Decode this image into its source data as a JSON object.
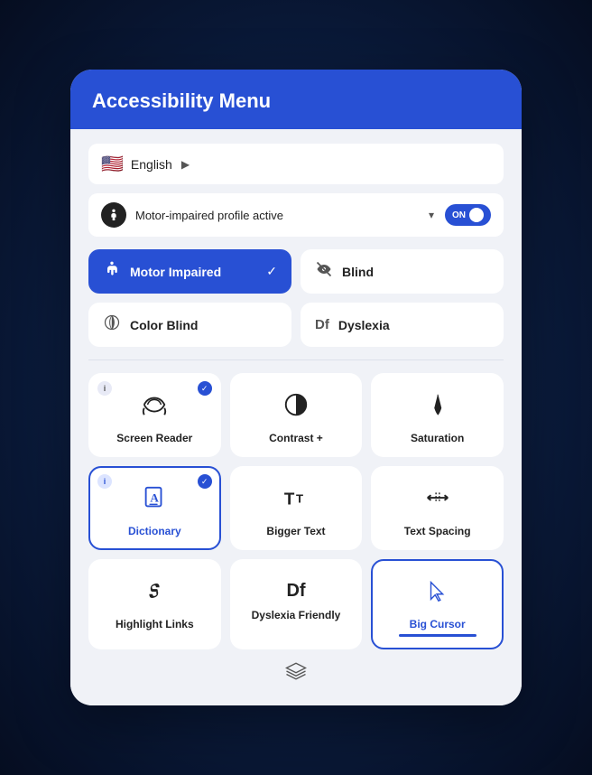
{
  "header": {
    "title": "Accessibility Menu"
  },
  "language": {
    "label": "English",
    "arrow": "▶"
  },
  "profile": {
    "label": "Motor-impaired profile active",
    "dropdown_arrow": "▾",
    "toggle_label": "ON"
  },
  "profiles": [
    {
      "id": "motor-impaired",
      "label": "Motor Impaired",
      "active": true
    },
    {
      "id": "blind",
      "label": "Blind",
      "active": false
    },
    {
      "id": "color-blind",
      "label": "Color Blind",
      "active": false
    },
    {
      "id": "dyslexia",
      "label": "Dyslexia",
      "active": false
    }
  ],
  "features": [
    {
      "id": "screen-reader",
      "label": "Screen Reader",
      "has_info": true,
      "has_check": true,
      "active": false
    },
    {
      "id": "contrast",
      "label": "Contrast +",
      "has_info": false,
      "has_check": false,
      "active": false
    },
    {
      "id": "saturation",
      "label": "Saturation",
      "has_info": false,
      "has_check": false,
      "active": false
    },
    {
      "id": "dictionary",
      "label": "Dictionary",
      "has_info": true,
      "has_check": true,
      "active": true
    },
    {
      "id": "bigger-text",
      "label": "Bigger Text",
      "has_info": false,
      "has_check": false,
      "active": false
    },
    {
      "id": "text-spacing",
      "label": "Text Spacing",
      "has_info": false,
      "has_check": false,
      "active": false
    },
    {
      "id": "highlight-links",
      "label": "Highlight Links",
      "has_info": false,
      "has_check": false,
      "active": false
    },
    {
      "id": "dyslexia-friendly",
      "label": "Dyslexia Friendly",
      "has_info": false,
      "has_check": false,
      "active": false
    },
    {
      "id": "big-cursor",
      "label": "Big Cursor",
      "has_info": false,
      "has_check": false,
      "active": true
    }
  ]
}
